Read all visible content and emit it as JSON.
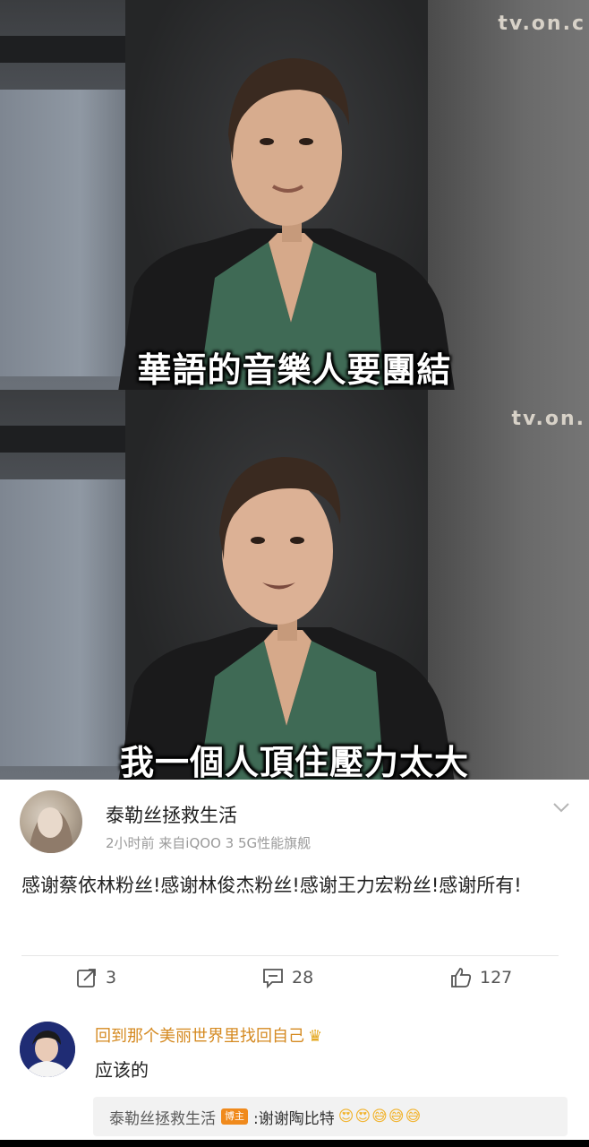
{
  "frames": [
    {
      "watermark": "tv.on.c",
      "subtitle": "華語的音樂人要團結"
    },
    {
      "watermark": "tv.on.",
      "subtitle": "我一個人頂住壓力太大"
    }
  ],
  "post": {
    "username": "泰勒丝拯救生活",
    "meta": "2小时前  来自iQOO 3 5G性能旗舰",
    "text": "感谢蔡依林粉丝!感谢林俊杰粉丝!感谢王力宏粉丝!感谢所有!",
    "actions": {
      "share_count": "3",
      "comment_count": "28",
      "like_count": "127"
    },
    "icons": {
      "share": "share-icon",
      "comment": "comment-icon",
      "like": "thumbs-up-icon",
      "more": "chevron-down-icon"
    }
  },
  "reply": {
    "username": "回到那个美丽世界里找回自己",
    "badge_icon": "crown-icon",
    "text": "应该的",
    "sub_reply": {
      "username": "泰勒丝拯救生活",
      "badge": "博主",
      "text": ":谢谢陶比特",
      "emojis": "😍😍😅😅😅"
    }
  },
  "colors": {
    "reply_name": "#d58a21",
    "badge": "#f08a1c"
  }
}
